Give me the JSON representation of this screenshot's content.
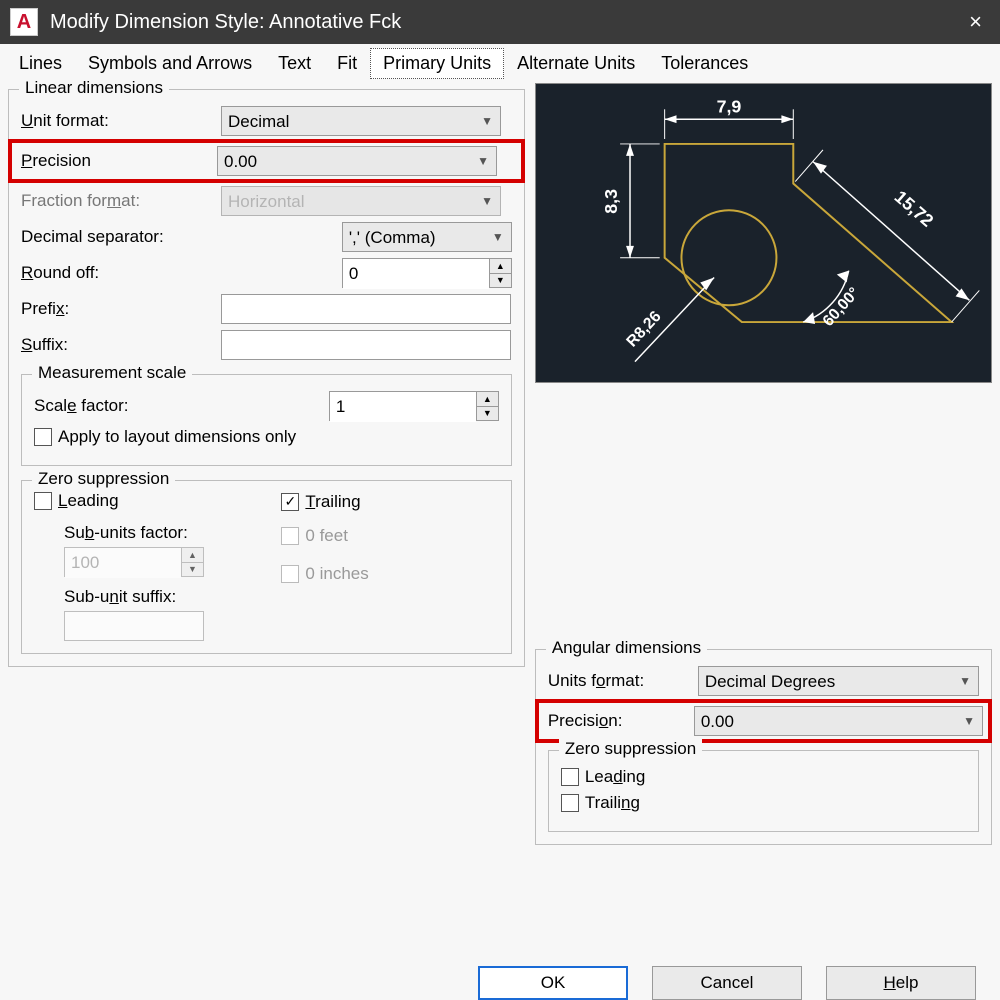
{
  "titlebar": {
    "icon_letter": "A",
    "title": "Modify Dimension Style: Annotative Fck",
    "close": "×"
  },
  "tabs": [
    "Lines",
    "Symbols and Arrows",
    "Text",
    "Fit",
    "Primary Units",
    "Alternate Units",
    "Tolerances"
  ],
  "active_tab": "Primary Units",
  "linear": {
    "legend": "Linear dimensions",
    "unit_format": {
      "label": "Unit format:",
      "value": "Decimal"
    },
    "precision": {
      "label": "Precision",
      "value": "0.00"
    },
    "fraction_format": {
      "label": "Fraction format:",
      "value": "Horizontal"
    },
    "decimal_separator": {
      "label": "Decimal separator:",
      "value": "',' (Comma)"
    },
    "round_off": {
      "label": "Round off:",
      "value": "0"
    },
    "prefix": {
      "label": "Prefix:",
      "value": ""
    },
    "suffix": {
      "label": "Suffix:",
      "value": ""
    }
  },
  "measurement": {
    "legend": "Measurement scale",
    "scale_factor": {
      "label": "Scale factor:",
      "value": "1"
    },
    "apply_layout": {
      "label": "Apply to layout dimensions only",
      "checked": false
    }
  },
  "zero_linear": {
    "legend": "Zero suppression",
    "leading": {
      "label": "Leading",
      "checked": false
    },
    "trailing": {
      "label": "Trailing",
      "checked": true
    },
    "subunits_factor": {
      "label": "Sub-units factor:",
      "value": "100"
    },
    "subunit_suffix": {
      "label": "Sub-unit suffix:",
      "value": ""
    },
    "zero_feet": {
      "label": "0 feet",
      "checked": false
    },
    "zero_inches": {
      "label": "0 inches",
      "checked": false
    }
  },
  "preview": {
    "dim_top": "7,9",
    "dim_left": "8,3",
    "dim_diag": "15,72",
    "dim_angle": "60,00°",
    "dim_radius": "R8,26"
  },
  "angular": {
    "legend": "Angular dimensions",
    "units_format": {
      "label": "Units format:",
      "value": "Decimal Degrees"
    },
    "precision": {
      "label": "Precision:",
      "value": "0.00"
    }
  },
  "zero_angular": {
    "legend": "Zero suppression",
    "leading": {
      "label": "Leading",
      "checked": false
    },
    "trailing": {
      "label": "Trailing",
      "checked": false
    }
  },
  "buttons": {
    "ok": "OK",
    "cancel": "Cancel",
    "help": "Help"
  }
}
